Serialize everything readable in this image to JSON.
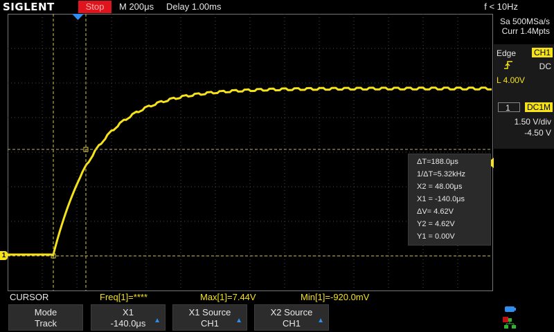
{
  "topbar": {
    "logo": "SIGLENT",
    "run_state": "Stop",
    "timebase": "M 200μs",
    "delay": "Delay 1.00ms",
    "freq_counter": "f < 10Hz"
  },
  "acquisition": {
    "sample_rate": "Sa 500MSa/s",
    "memory_depth": "Curr 1.4Mpts"
  },
  "trigger": {
    "type": "Edge",
    "source": "CH1",
    "slope_icon": "rising-edge-icon",
    "coupling": "DC",
    "level": "L  4.00V"
  },
  "channel": {
    "number": "1",
    "coupling": "DC1M",
    "volts_per_div": "1.50 V/div",
    "offset": "-4.50 V"
  },
  "cursor_readout": {
    "delta_t": "ΔT=188.0μs",
    "inv_delta_t": "1/ΔT=5.32kHz",
    "x2": "X2 = 48.00μs",
    "x1": "X1 = -140.0μs",
    "delta_v": "ΔV= 4.62V",
    "y2": "Y2 = 4.62V",
    "y1": "Y1 = 0.00V"
  },
  "status": {
    "menu_title": "CURSOR",
    "freq": "Freq[1]=****",
    "max": "Max[1]=7.44V",
    "min": "Min[1]=-920.0mV"
  },
  "softkeys": {
    "mode": {
      "line1": "Mode",
      "line2": "Track"
    },
    "x1": {
      "line1": "X1",
      "line2": "-140.0μs"
    },
    "x1_source": {
      "line1": "X1 Source",
      "line2": "CH1"
    },
    "x2_source": {
      "line1": "X2 Source",
      "line2": "CH1"
    }
  },
  "colors": {
    "trace": "#f5e21a",
    "stop": "#e0141c",
    "grid": "#555555",
    "accent": "#2f8ff0"
  },
  "markers": {
    "ch1_ground": "1"
  }
}
